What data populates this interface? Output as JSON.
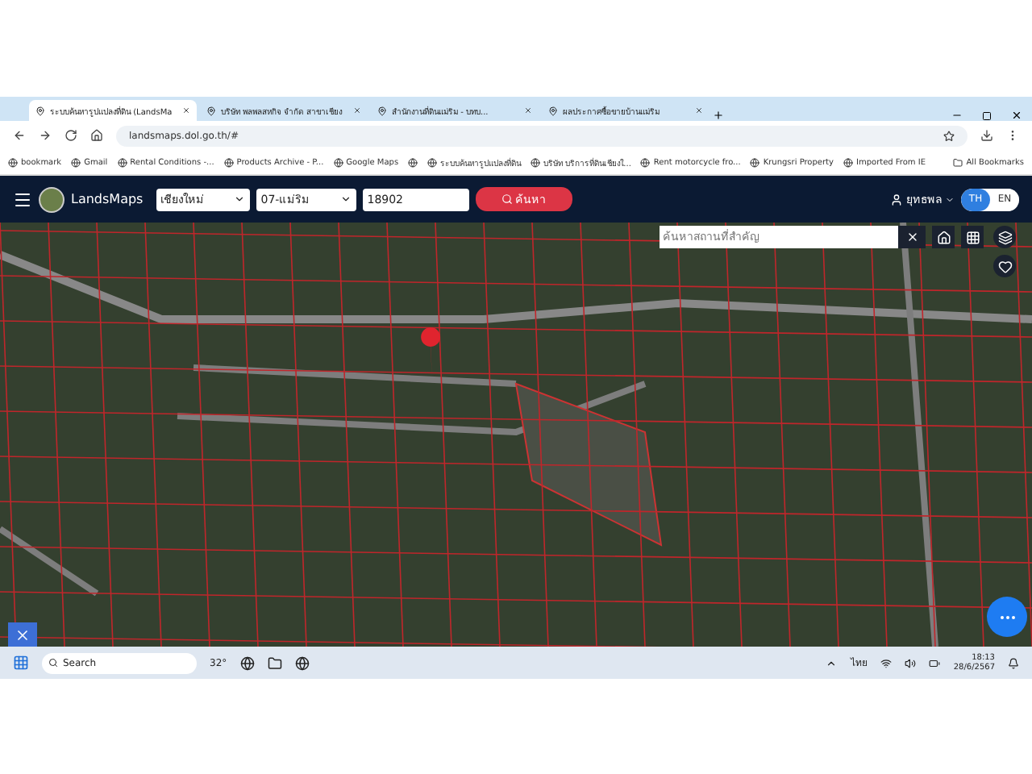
{
  "tabs": [
    {
      "title": "ระบบค้นหารูปแปลงที่ดิน (LandsMa",
      "selected": true
    },
    {
      "title": "บริษัท พลพลสหกิจ จำกัด สาขาเชียง",
      "selected": false
    },
    {
      "title": "สำนักงานที่ดินแม่ริม - บทบ...",
      "selected": false
    },
    {
      "title": "ผลประกาศซื้อขายบ้านแม่ริม",
      "selected": false
    }
  ],
  "address": "landsmaps.dol.go.th/#",
  "bookmarks": [
    "bookmark",
    "Gmail",
    "Rental Conditions -...",
    "Products Archive - P...",
    "Google Maps",
    "ระบบค้นหารูปแปลงที่ดิน",
    "บริษัท บริการที่ดินเชียงใ...",
    "Rent motorcycle fro...",
    "Krungsri Property",
    "Imported From IE"
  ],
  "all_bookmarks": "All Bookmarks",
  "app": {
    "brand": "LandsMaps",
    "province": "เชียงใหม่",
    "district": "07-แม่ริม",
    "parcel": "18902",
    "search_button": "ค้นหา",
    "user": "ยุทธพล",
    "languages": [
      {
        "label": "TH",
        "selected": true
      },
      {
        "label": "EN",
        "selected": false
      }
    ]
  },
  "map": {
    "place_search": {
      "placeholder": "ค้นหาสถานที่สำคัญ"
    }
  },
  "taskbar": {
    "search": "Search",
    "weather": "32°",
    "language": "ไทย",
    "time": "18:13",
    "date": "28/6/2567"
  }
}
